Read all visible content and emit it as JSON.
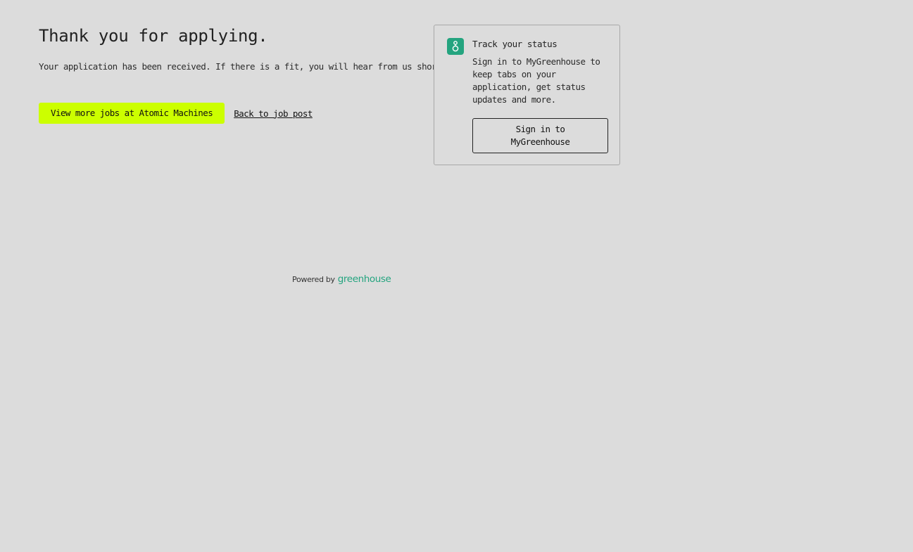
{
  "main": {
    "title": "Thank you for applying.",
    "message": "Your application has been received. If there is a fit, you will hear from us shortly.",
    "primary_button_label": "View more jobs at Atomic Machines",
    "back_link_label": "Back to job post"
  },
  "status_card": {
    "logo_icon": "greenhouse-logo-icon",
    "title": "Track your status",
    "description": "Sign in to MyGreenhouse to keep tabs on your application, get status updates and more.",
    "signin_button_label": "Sign in to MyGreenhouse"
  },
  "footer": {
    "powered_by": "Powered by",
    "brand": "greenhouse"
  },
  "colors": {
    "background": "#dcdcdc",
    "accent_button": "#ccff00",
    "brand_green": "#24a47f"
  }
}
